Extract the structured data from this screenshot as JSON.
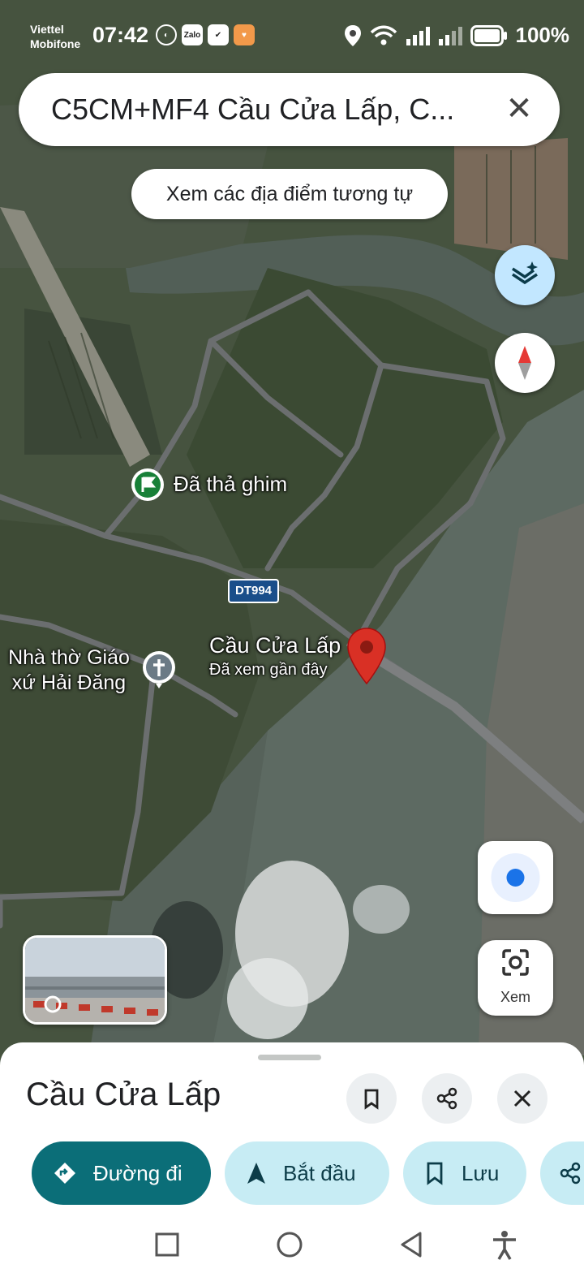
{
  "status_bar": {
    "carrier_1": "Viettel",
    "carrier_2": "Mobifone",
    "time": "07:42",
    "app_icons": [
      "zalo-icon",
      "check-icon",
      "heart-icon"
    ],
    "battery": "100%"
  },
  "search": {
    "query": "C5CM+MF4 Cầu Cửa Lấp, C..."
  },
  "suggestion_chip": "Xem các địa điểm tương tự",
  "map": {
    "labels": {
      "dropped_pin": "Đã thả ghim",
      "road_shield": "DT994",
      "place_name": "Cầu Cửa Lấp",
      "place_sub": "Đã xem gần đây",
      "church_line1": "Nhà thờ Giáo",
      "church_line2": "xứ Hải Đăng"
    },
    "lens_label": "Xem"
  },
  "sheet": {
    "title": "Cầu Cửa Lấp",
    "actions": {
      "directions": "Đường đi",
      "start": "Bắt đầu",
      "save": "Lưu"
    }
  },
  "colors": {
    "primary_button": "#0b6e78",
    "secondary_button": "#c7ecf4",
    "pin": "#d93025",
    "layers_fab": "#c2e7ff"
  }
}
